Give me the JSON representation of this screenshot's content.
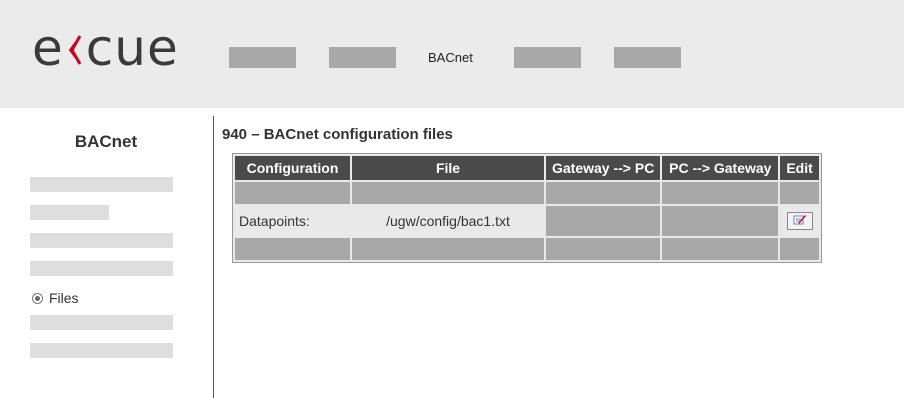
{
  "header": {
    "logo": {
      "text_left": "e",
      "mark_icon": "ecue-bracket-logo-mark",
      "text_right": "cue",
      "mark_color": "#d0021b"
    },
    "nav": {
      "active_label": "BACnet"
    }
  },
  "sidebar": {
    "title": "BACnet",
    "files_label": "Files"
  },
  "main": {
    "title": "940 – BACnet configuration files",
    "table": {
      "headers": [
        "Configuration",
        "File",
        "Gateway --> PC",
        "PC --> Gateway",
        "Edit"
      ],
      "row_datapoints": {
        "configuration": "Datapoints:",
        "file": "/ugw/config/bac1.txt",
        "edit_icon": "edit-pencil-icon"
      }
    }
  },
  "colors": {
    "header_bg": "#ebebeb",
    "table_header_bg": "#4a4a4a",
    "placeholder": "#a8a8a8"
  }
}
